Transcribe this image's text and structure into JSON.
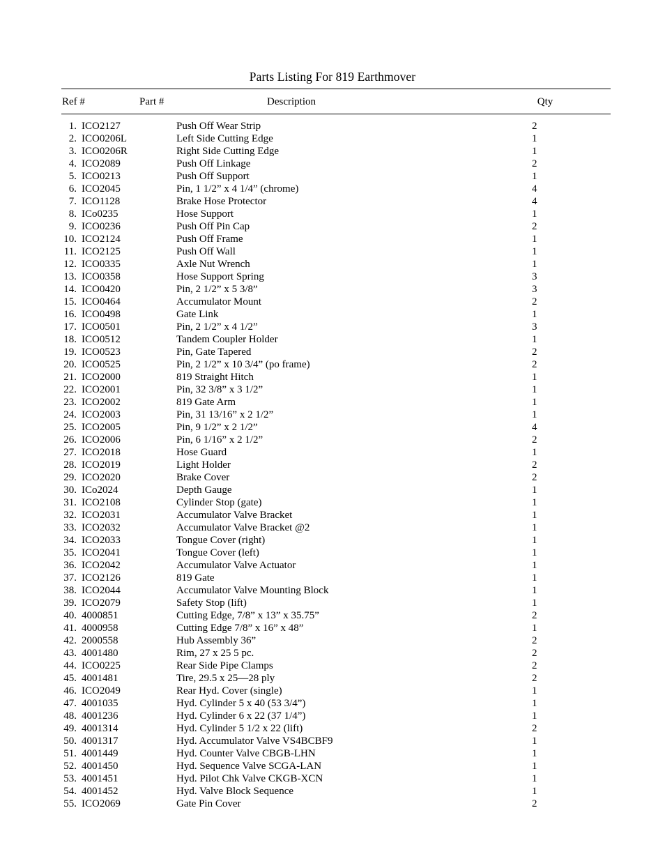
{
  "document": {
    "title": "Parts Listing For 819 Earthmover"
  },
  "table": {
    "columns": {
      "ref": "Ref #",
      "part": "Part #",
      "description": "Description",
      "qty": "Qty"
    },
    "rows": [
      {
        "num": "1.",
        "part": "ICO2127",
        "desc": "Push Off Wear Strip",
        "qty": "2"
      },
      {
        "num": "2.",
        "part": "ICO0206L",
        "desc": "Left Side Cutting Edge",
        "qty": "1"
      },
      {
        "num": "3.",
        "part": "ICO0206R",
        "desc": "Right Side Cutting Edge",
        "qty": "1"
      },
      {
        "num": "4.",
        "part": "ICO2089",
        "desc": "Push Off Linkage",
        "qty": "2"
      },
      {
        "num": "5.",
        "part": "ICO0213",
        "desc": "Push Off Support",
        "qty": "1"
      },
      {
        "num": "6.",
        "part": "ICO2045",
        "desc": "Pin, 1 1/2” x 4 1/4” (chrome)",
        "qty": "4"
      },
      {
        "num": "7.",
        "part": "ICO1128",
        "desc": "Brake Hose Protector",
        "qty": "4"
      },
      {
        "num": "8.",
        "part": "ICo0235",
        "desc": "Hose Support",
        "qty": "1"
      },
      {
        "num": "9.",
        "part": "ICO0236",
        "desc": "Push Off Pin Cap",
        "qty": "2"
      },
      {
        "num": "10.",
        "part": "ICO2124",
        "desc": "Push Off Frame",
        "qty": "1"
      },
      {
        "num": "11.",
        "part": "ICO2125",
        "desc": "Push Off Wall",
        "qty": "1"
      },
      {
        "num": "12.",
        "part": "ICO0335",
        "desc": "Axle Nut Wrench",
        "qty": "1"
      },
      {
        "num": "13.",
        "part": "ICO0358",
        "desc": "Hose Support Spring",
        "qty": "3"
      },
      {
        "num": "14.",
        "part": "ICO0420",
        "desc": "Pin, 2 1/2” x 5 3/8”",
        "qty": "3"
      },
      {
        "num": "15.",
        "part": "ICO0464",
        "desc": "Accumulator Mount",
        "qty": "2"
      },
      {
        "num": "16.",
        "part": "ICO0498",
        "desc": "Gate Link",
        "qty": "1"
      },
      {
        "num": "17.",
        "part": "ICO0501",
        "desc": "Pin, 2 1/2” x 4 1/2”",
        "qty": "3"
      },
      {
        "num": "18.",
        "part": "ICO0512",
        "desc": "Tandem Coupler Holder",
        "qty": "1"
      },
      {
        "num": "19.",
        "part": "ICO0523",
        "desc": "Pin, Gate Tapered",
        "qty": "2"
      },
      {
        "num": "20.",
        "part": "ICO0525",
        "desc": "Pin, 2 1/2” x 10 3/4” (po frame)",
        "qty": "2"
      },
      {
        "num": "21.",
        "part": "ICO2000",
        "desc": "819 Straight Hitch",
        "qty": "1"
      },
      {
        "num": "22.",
        "part": "ICO2001",
        "desc": "Pin, 32 3/8” x 3 1/2”",
        "qty": "1"
      },
      {
        "num": "23.",
        "part": "ICO2002",
        "desc": "819 Gate Arm",
        "qty": "1"
      },
      {
        "num": "24.",
        "part": "ICO2003",
        "desc": "Pin, 31 13/16” x 2 1/2”",
        "qty": "1"
      },
      {
        "num": "25.",
        "part": "ICO2005",
        "desc": "Pin, 9 1/2” x 2 1/2”",
        "qty": "4"
      },
      {
        "num": "26.",
        "part": "ICO2006",
        "desc": "Pin, 6 1/16” x 2 1/2”",
        "qty": "2"
      },
      {
        "num": "27.",
        "part": "ICO2018",
        "desc": "Hose Guard",
        "qty": "1"
      },
      {
        "num": "28.",
        "part": "ICO2019",
        "desc": "Light Holder",
        "qty": "2"
      },
      {
        "num": "29.",
        "part": "ICO2020",
        "desc": "Brake Cover",
        "qty": "2"
      },
      {
        "num": "30.",
        "part": "ICo2024",
        "desc": "Depth Gauge",
        "qty": "1"
      },
      {
        "num": "31.",
        "part": "ICO2108",
        "desc": "Cylinder Stop (gate)",
        "qty": "1"
      },
      {
        "num": "32.",
        "part": "ICO2031",
        "desc": "Accumulator Valve Bracket",
        "qty": "1"
      },
      {
        "num": "33.",
        "part": "ICO2032",
        "desc": "Accumulator Valve Bracket @2",
        "qty": "1"
      },
      {
        "num": "34.",
        "part": "ICO2033",
        "desc": "Tongue Cover (right)",
        "qty": "1"
      },
      {
        "num": "35.",
        "part": "ICO2041",
        "desc": "Tongue Cover (left)",
        "qty": "1"
      },
      {
        "num": "36.",
        "part": "ICO2042",
        "desc": "Accumulator Valve Actuator",
        "qty": "1"
      },
      {
        "num": "37.",
        "part": "ICO2126",
        "desc": "819 Gate",
        "qty": "1"
      },
      {
        "num": "38.",
        "part": "ICO2044",
        "desc": "Accumulator Valve Mounting Block",
        "qty": "1"
      },
      {
        "num": "39.",
        "part": "ICO2079",
        "desc": "Safety Stop (lift)",
        "qty": "1"
      },
      {
        "num": "40.",
        "part": "4000851",
        "desc": "Cutting Edge, 7/8” x 13” x 35.75”",
        "qty": "2"
      },
      {
        "num": "41.",
        "part": "4000958",
        "desc": "Cutting Edge 7/8” x 16” x 48”",
        "qty": "1"
      },
      {
        "num": "42.",
        "part": "2000558",
        "desc": "Hub Assembly 36”",
        "qty": "2"
      },
      {
        "num": "43.",
        "part": "4001480",
        "desc": "Rim, 27 x 25 5 pc.",
        "qty": "2"
      },
      {
        "num": "44.",
        "part": "ICO0225",
        "desc": "Rear Side Pipe Clamps",
        "qty": "2"
      },
      {
        "num": "45.",
        "part": "4001481",
        "desc": "Tire, 29.5 x 25—28 ply",
        "qty": "2"
      },
      {
        "num": "46.",
        "part": "ICO2049",
        "desc": "Rear Hyd. Cover (single)",
        "qty": "1"
      },
      {
        "num": "47.",
        "part": "4001035",
        "desc": "Hyd. Cylinder 5 x 40 (53 3/4”)",
        "qty": "1"
      },
      {
        "num": "48.",
        "part": "4001236",
        "desc": "Hyd. Cylinder 6 x 22 (37 1/4”)",
        "qty": "1"
      },
      {
        "num": "49.",
        "part": "4001314",
        "desc": "Hyd. Cylinder 5 1/2 x 22 (lift)",
        "qty": "2"
      },
      {
        "num": "50.",
        "part": "4001317",
        "desc": "Hyd. Accumulator Valve VS4BCBF9",
        "qty": "1"
      },
      {
        "num": "51.",
        "part": "4001449",
        "desc": "Hyd. Counter Valve CBGB-LHN",
        "qty": "1"
      },
      {
        "num": "52.",
        "part": "4001450",
        "desc": "Hyd. Sequence Valve SCGA-LAN",
        "qty": "1"
      },
      {
        "num": "53.",
        "part": "4001451",
        "desc": "Hyd. Pilot Chk Valve CKGB-XCN",
        "qty": "1"
      },
      {
        "num": "54.",
        "part": "4001452",
        "desc": "Hyd. Valve Block Sequence",
        "qty": "1"
      },
      {
        "num": "55.",
        "part": "ICO2069",
        "desc": "Gate Pin Cover",
        "qty": "2"
      }
    ]
  }
}
